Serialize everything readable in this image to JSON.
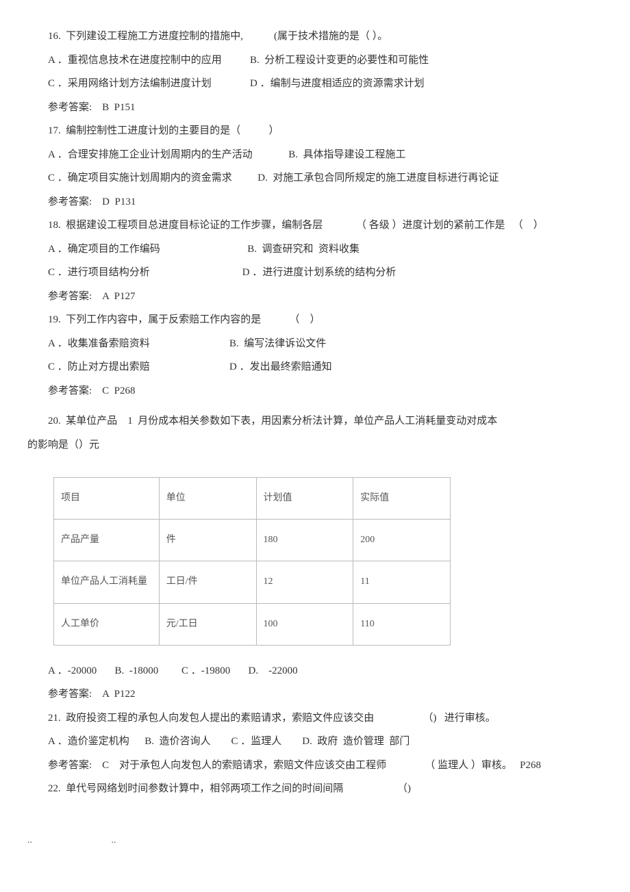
{
  "q16": {
    "stem": "16.  下列建设工程施工方进度控制的措施中,            (属于技术措施的是（ ）。",
    "row1": "A ．重视信息技术在进度控制中的应用           B.  分析工程设计变更的必要性和可能性",
    "row2": "C ．采用网络计划方法编制进度计划               D ．编制与进度相适应的资源需求计划",
    "ans": "参考答案:    B  P151"
  },
  "q17": {
    "stem": "17.  编制控制性工进度计划的主要目的是（           ）",
    "row1": "A ．合理安排施工企业计划周期内的生产活动              B.  具体指导建设工程施工",
    "row2": "C ．确定项目实施计划周期内的资金需求          D.  对施工承包合同所规定的施工进度目标进行再论证",
    "ans": "参考答案:    D  P131"
  },
  "q18": {
    "stem": "18.  根据建设工程项目总进度目标论证的工作步骤，编制各层             （ 各级 ）进度计划的紧前工作是   （    ）",
    "row1": "A ．确定项目的工作编码                                  B.  调查研究和  资料收集",
    "row2": "C ．进行项目结构分析                                    D ．进行进度计划系统的结构分析",
    "ans": "参考答案:    A  P127"
  },
  "q19": {
    "stem": "19.  下列工作内容中，属于反索赔工作内容的是           （    ）",
    "row1": "A ．收集准备索赔资料                               B.  编写法律诉讼文件",
    "row2": "C ．防止对方提出索赔                               D ．发出最终索赔通知",
    "ans": "参考答案:    C  P268"
  },
  "q20": {
    "stem1": "20.  某单位产品    1  月份成本相关参数如下表，用因素分析法计算，单位产品人工消耗量变动对成本",
    "stem2": "的影响是（）元",
    "table": {
      "h": [
        "项目",
        "单位",
        "计划值",
        "实际值"
      ],
      "r1": [
        "产品产量",
        "件",
        "180",
        "200"
      ],
      "r2": [
        "单位产品人工消耗量",
        "工日/件",
        "12",
        "11"
      ],
      "r3": [
        "人工单价",
        "元/工日",
        "100",
        "110"
      ]
    },
    "opts": "A ．-20000       B.  -18000         C ．-19800       D.    -22000",
    "ans": "参考答案:    A  P122"
  },
  "q21": {
    "stem": "21.  政府投资工程的承包人向发包人提出的素赔请求，索赔文件应该交由                   （)   进行审核。",
    "row1": "A ．造价鉴定机构      B.  造价咨询人        C ．监理人        D.  政府  造价管理  部门",
    "ans": "参考答案:    C    对于承包人向发包人的索赔请求，索赔文件应该交由工程师               （ 监理人 ）审核。   P268"
  },
  "q22": {
    "stem": "22.  单代号网络划时间参数计算中，相邻两项工作之间的时间间隔                     （)"
  },
  "footer": "..                                 .."
}
